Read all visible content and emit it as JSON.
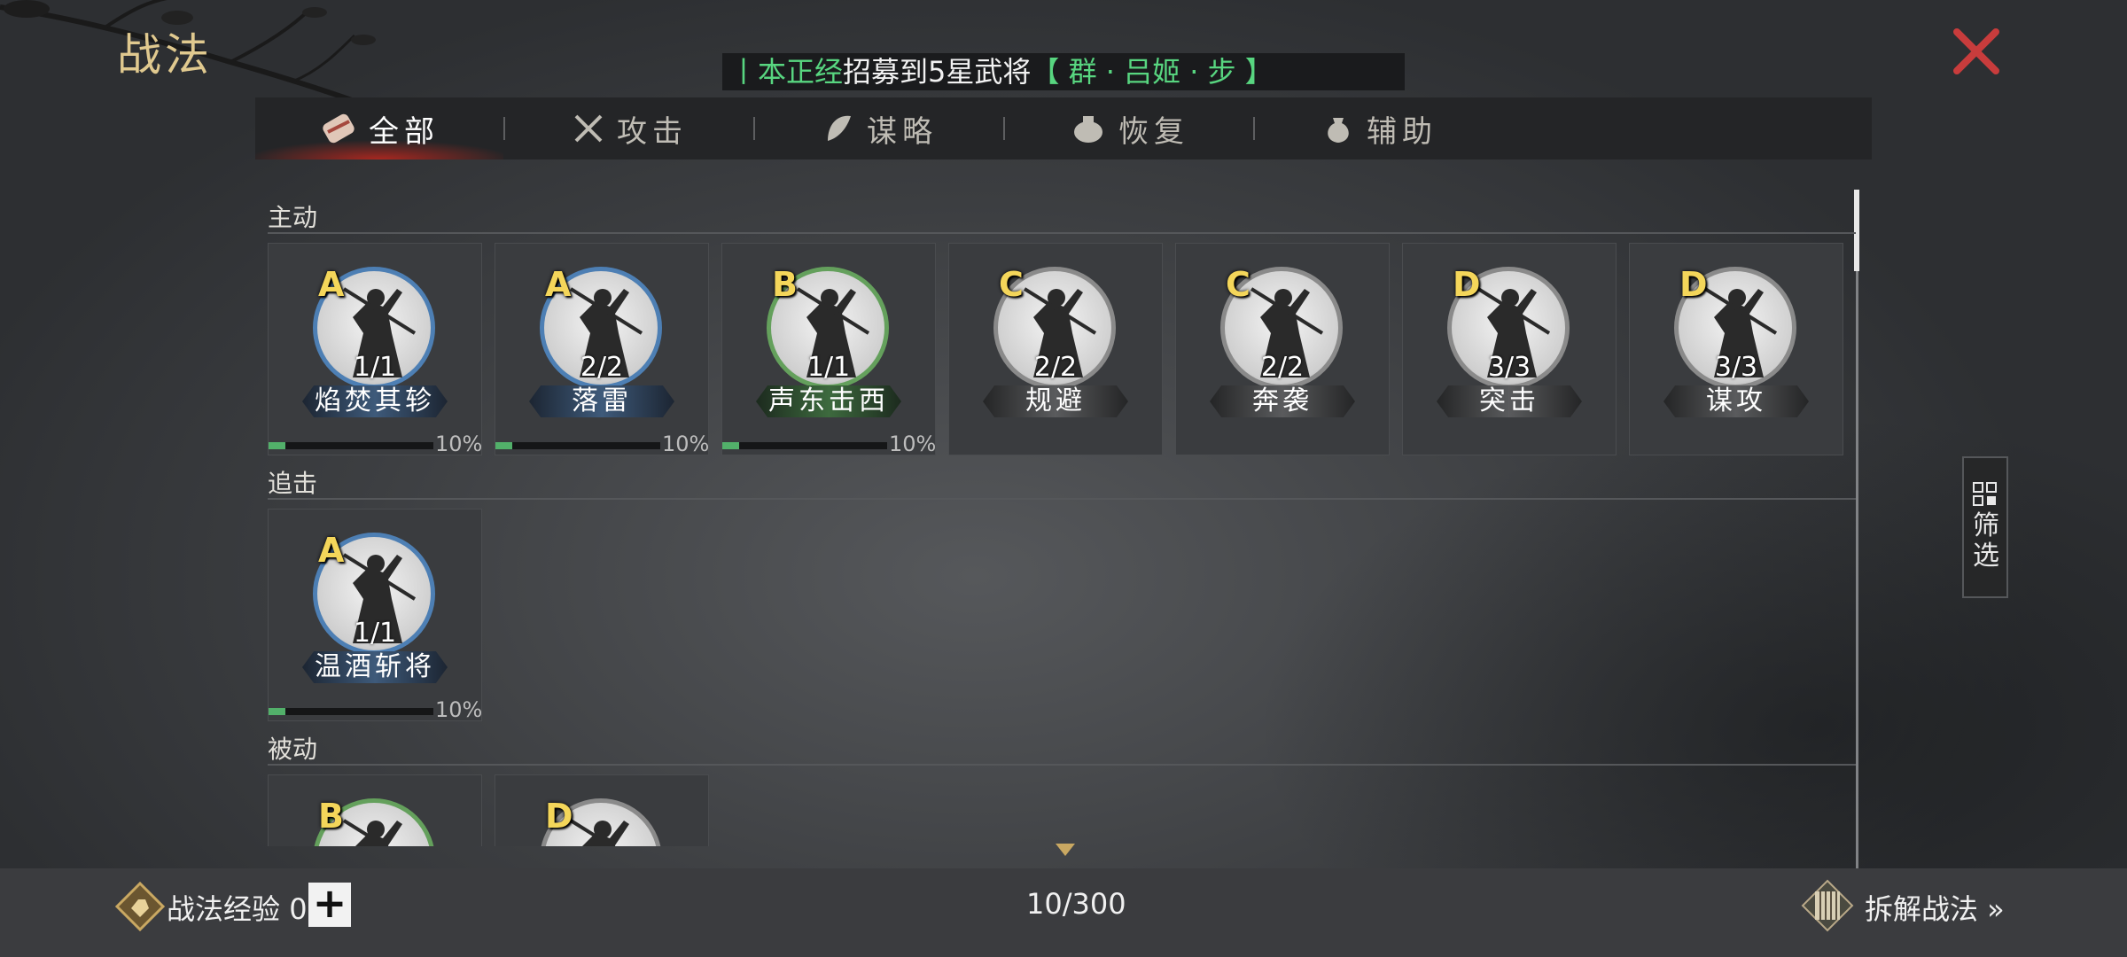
{
  "header": {
    "title": "战法",
    "close_icon": "close-icon",
    "accent_color": "#d04a4a"
  },
  "ticker": {
    "prefix": "丨",
    "player": "本正经",
    "message": "招募到5星武将",
    "hero": "【 群 · 吕姬 · 步 】"
  },
  "tabs": [
    {
      "label": "全部",
      "icon": "scroll-bundle-icon",
      "active": true
    },
    {
      "label": "攻击",
      "icon": "crossed-swords-icon",
      "active": false
    },
    {
      "label": "谋略",
      "icon": "feather-fan-icon",
      "active": false
    },
    {
      "label": "恢复",
      "icon": "medicine-pot-icon",
      "active": false
    },
    {
      "label": "辅助",
      "icon": "pouch-icon",
      "active": false
    }
  ],
  "sections": {
    "active": {
      "label": "主动",
      "cards": [
        {
          "grade": "A",
          "count": "1/1",
          "name": "焰焚其轸",
          "ring": "blue",
          "progress": "10%",
          "progress_value": 0.1
        },
        {
          "grade": "A",
          "count": "2/2",
          "name": "落雷",
          "ring": "blue",
          "progress": "10%",
          "progress_value": 0.1
        },
        {
          "grade": "B",
          "count": "1/1",
          "name": "声东击西",
          "ring": "green",
          "progress": "10%",
          "progress_value": 0.1
        },
        {
          "grade": "C",
          "count": "2/2",
          "name": "规避",
          "ring": "grey"
        },
        {
          "grade": "C",
          "count": "2/2",
          "name": "奔袭",
          "ring": "grey"
        },
        {
          "grade": "D",
          "count": "3/3",
          "name": "突击",
          "ring": "grey"
        },
        {
          "grade": "D",
          "count": "3/3",
          "name": "谋攻",
          "ring": "grey"
        }
      ]
    },
    "pursuit": {
      "label": "追击",
      "cards": [
        {
          "grade": "A",
          "count": "1/1",
          "name": "温酒斩将",
          "ring": "blue",
          "progress": "10%",
          "progress_value": 0.1
        }
      ]
    },
    "passive": {
      "label": "被动",
      "cards": [
        {
          "grade": "B",
          "ring": "green"
        },
        {
          "grade": "D",
          "ring": "grey"
        }
      ]
    }
  },
  "filter": {
    "label": "筛选",
    "icon": "grid-icon"
  },
  "footer": {
    "exp_label": "战法经验",
    "exp_value": "0",
    "plus": "+",
    "page_count": "10/300",
    "disassemble_label": "拆解战法 »"
  }
}
